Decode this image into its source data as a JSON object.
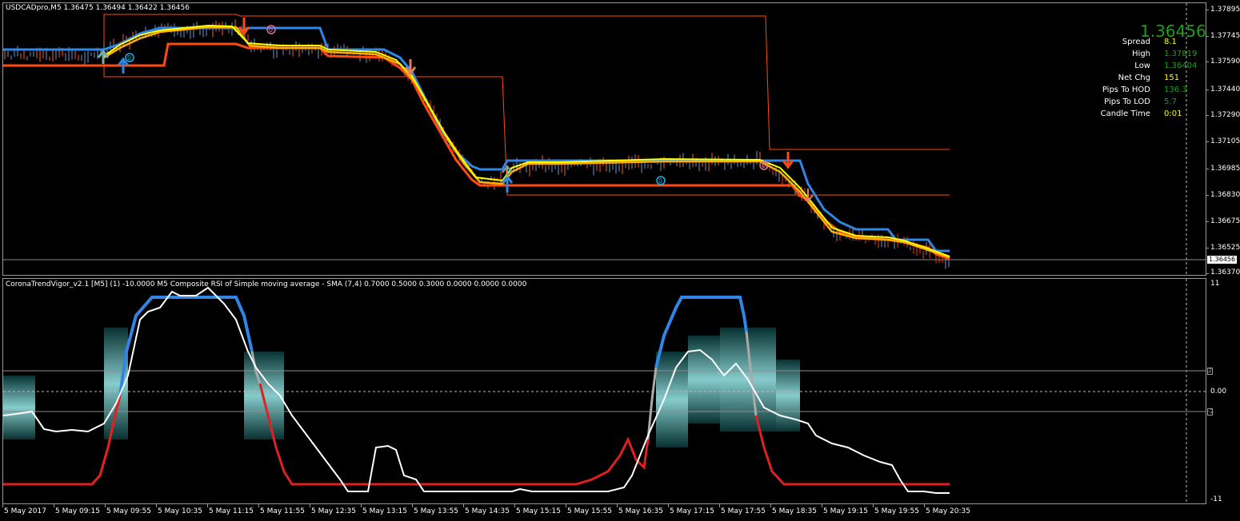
{
  "chart": {
    "title": "USDCADpro,M5  1.36475 1.36494 1.36422 1.36456",
    "price_axis": [
      "1.37895",
      "1.37745",
      "1.37590",
      "1.37440",
      "1.37290",
      "1.37105",
      "1.36985",
      "1.36830",
      "1.36675",
      "1.36525",
      "1.36370"
    ],
    "current_price_tag": "1.36456",
    "colors": {
      "upper_band": "#2f86e6",
      "lower_band": "#ff4a10",
      "fast_ma": "#ffff00",
      "slow_ma": "#ff8c1a",
      "bull_candle": "#4a8fd6",
      "bear_candle": "#ff3a00",
      "channel": "#ff4a10"
    }
  },
  "info_panel": {
    "price": "1.36456",
    "rows": [
      {
        "label": "Spread",
        "value": "8.1",
        "color": "#ffff00"
      },
      {
        "label": "High",
        "value": "1.37819",
        "color": "#1e9e1e"
      },
      {
        "label": "Low",
        "value": "1.36404",
        "color": "#1e9e1e"
      },
      {
        "label": "Net Chg",
        "value": "151",
        "color": "#ffff00"
      },
      {
        "label": "Pips To HOD",
        "value": "136.3",
        "color": "#1e9e1e"
      },
      {
        "label": "Pips To LOD",
        "value": "5.7",
        "color": "#1e9e1e"
      },
      {
        "label": "Candle Time",
        "value": "0:01",
        "color": "#ffff00"
      }
    ]
  },
  "indicator": {
    "title": "CoronaTrendVigor_v2.1 [M5] (1) -10.0000  M5 Composite RSI of Simple moving average - SMA (7,4) 0.7000 0.5000 0.3000 0.0000 0.0000 0.0000",
    "axis": {
      "top": "11",
      "mid": "0.00",
      "bottom": "-11",
      "upper_level": "2",
      "lower_level": "-2"
    },
    "colors": {
      "vigor_up": "#2f86e6",
      "vigor_down": "#e02020",
      "rsi_line": "#ffffff",
      "cloud": "#40c0c0"
    }
  },
  "time_axis": [
    "5 May 2017",
    "5 May 09:15",
    "5 May 09:55",
    "5 May 10:35",
    "5 May 11:15",
    "5 May 11:55",
    "5 May 12:35",
    "5 May 13:15",
    "5 May 13:55",
    "5 May 14:35",
    "5 May 15:15",
    "5 May 15:55",
    "5 May 16:35",
    "5 May 17:15",
    "5 May 17:55",
    "5 May 18:35",
    "5 May 19:15",
    "5 May 19:55",
    "5 May 20:35"
  ],
  "markers": {
    "zero_label": "0"
  }
}
